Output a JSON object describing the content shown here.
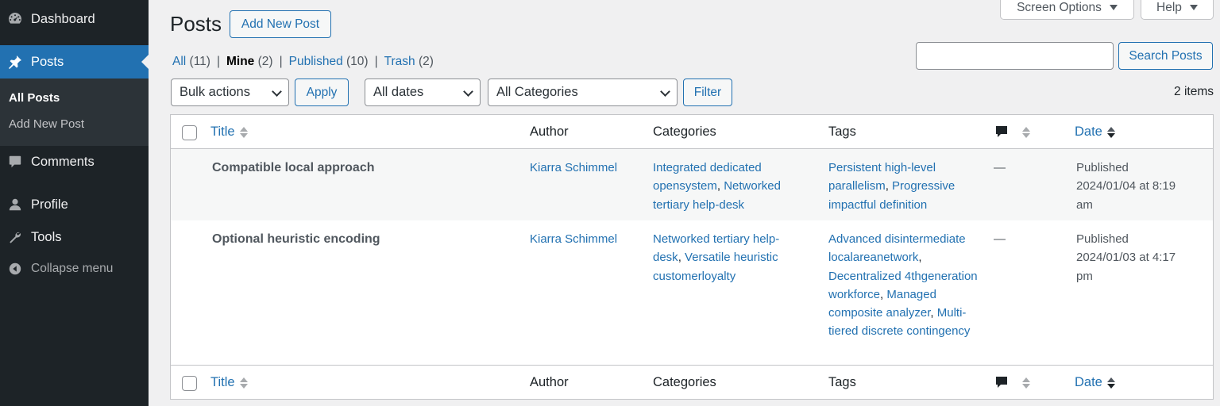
{
  "sidebar": {
    "items": [
      {
        "label": "Dashboard",
        "icon": "dashboard-icon"
      },
      {
        "label": "Posts",
        "icon": "pin-icon"
      },
      {
        "label": "Comments",
        "icon": "comment-icon"
      },
      {
        "label": "Profile",
        "icon": "user-icon"
      },
      {
        "label": "Tools",
        "icon": "wrench-icon"
      },
      {
        "label": "Collapse menu",
        "icon": "collapse-icon"
      }
    ],
    "submenu": [
      "All Posts",
      "Add New Post"
    ]
  },
  "header": {
    "title": "Posts",
    "add_new": "Add New Post",
    "screen_options": "Screen Options",
    "help": "Help"
  },
  "views": [
    {
      "label": "All",
      "count": "(11)"
    },
    {
      "label": "Mine",
      "count": "(2)"
    },
    {
      "label": "Published",
      "count": "(10)"
    },
    {
      "label": "Trash",
      "count": "(2)"
    }
  ],
  "search": {
    "value": "",
    "button": "Search Posts"
  },
  "filters": {
    "bulk_actions": "Bulk actions",
    "apply": "Apply",
    "dates": "All dates",
    "categories": "All Categories",
    "filter": "Filter",
    "items_count": "2 items"
  },
  "columns": {
    "title": "Title",
    "author": "Author",
    "categories": "Categories",
    "tags": "Tags",
    "date": "Date"
  },
  "rows": [
    {
      "title": "Compatible local approach",
      "author": "Kiarra Schimmel",
      "categories": [
        "Integrated dedicated opensystem",
        "Networked tertiary help-desk"
      ],
      "tags": [
        "Persistent high-level parallelism",
        "Progressive impactful definition"
      ],
      "comments": "—",
      "status": "Published",
      "date": "2024/01/04 at 8:19 am"
    },
    {
      "title": "Optional heuristic encoding",
      "author": "Kiarra Schimmel",
      "categories": [
        "Networked tertiary help-desk",
        "Versatile heuristic customerloyalty"
      ],
      "tags": [
        "Advanced disintermediate localareanetwork",
        "Decentralized 4thgeneration workforce",
        "Managed composite analyzer",
        "Multi-tiered discrete contingency"
      ],
      "comments": "—",
      "status": "Published",
      "date": "2024/01/03 at 4:17 pm"
    }
  ],
  "colors": {
    "sidebar_bg": "#1d2327",
    "accent": "#2271b1",
    "submenu_bg": "#2c3338"
  }
}
